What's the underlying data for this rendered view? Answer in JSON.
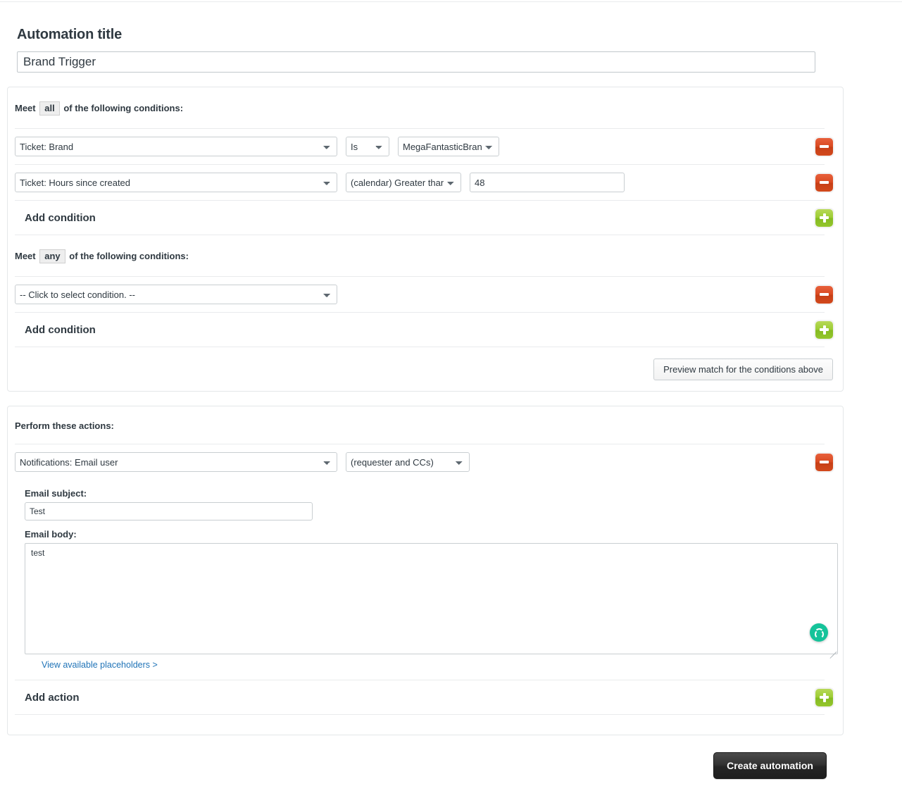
{
  "title_section": {
    "label": "Automation title",
    "value": "Brand Trigger",
    "placeholder": "Automation title"
  },
  "conditions_all": {
    "heading_prefix": "Meet",
    "heading_chip": "all",
    "heading_suffix": "of the following conditions:",
    "rows": [
      {
        "subject": "Ticket: Brand",
        "operator": "Is",
        "value": "MegaFantasticBrand",
        "remove_label": "Remove condition"
      },
      {
        "subject": "Ticket: Hours since created",
        "operator": "(calendar) Greater than",
        "value": "48",
        "remove_label": "Remove condition"
      }
    ],
    "add_label": "Add condition",
    "add_button_label": "Add condition"
  },
  "conditions_any": {
    "heading_prefix": "Meet",
    "heading_chip": "any",
    "heading_suffix": "of the following conditions:",
    "rows": [
      {
        "subject": "-- Click to select condition. --",
        "remove_label": "Remove condition"
      }
    ],
    "add_label": "Add condition",
    "add_button_label": "Add condition"
  },
  "preview": {
    "button_label": "Preview match for the conditions above"
  },
  "actions": {
    "heading": "Perform these actions:",
    "rows": [
      {
        "action": "Notifications: Email user",
        "target": "(requester and CCs)",
        "remove_label": "Remove action",
        "subject_label": "Email subject:",
        "subject_value": "Test",
        "subject_placeholder": "Email subject",
        "body_label": "Email body:",
        "body_value": "test",
        "body_placeholder": "Email body",
        "placeholder_link": "View available placeholders >",
        "assistant_badge": "grammar-assistant"
      }
    ],
    "add_label": "Add action",
    "add_button_label": "Add action"
  },
  "submit": {
    "label": "Create automation"
  },
  "colors": {
    "remove_button": "#d94a21",
    "add_button": "#9ccc33",
    "link": "#1f73b7",
    "submit_button": "#333333",
    "assistant_badge": "#15c39a",
    "panel_border": "#e4e7e9",
    "divider": "#e9ebed"
  }
}
